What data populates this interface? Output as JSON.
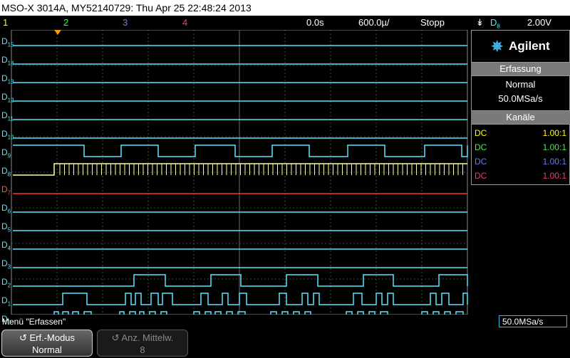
{
  "title_bar": "MSO-X 3014A, MY52140729: Thu Apr 25 22:48:24 2013",
  "top_bar": {
    "channels": [
      {
        "label": "1",
        "color": "#ffff00"
      },
      {
        "label": "2",
        "color": "#44ee44"
      },
      {
        "label": "3",
        "color": "#6677ff"
      },
      {
        "label": "4",
        "color": "#ff3377"
      }
    ],
    "time_position": "0.0s",
    "time_scale": "600.0µ/",
    "run_state": "Stopp",
    "trigger_source": "D",
    "trigger_source_sub": "8",
    "trigger_level": "2.00V"
  },
  "digital_channels": [
    {
      "label": "D",
      "sub": "15"
    },
    {
      "label": "D",
      "sub": "14"
    },
    {
      "label": "D",
      "sub": "13"
    },
    {
      "label": "D",
      "sub": "12"
    },
    {
      "label": "D",
      "sub": "11"
    },
    {
      "label": "D",
      "sub": "10"
    },
    {
      "label": "D",
      "sub": "9"
    },
    {
      "label": "D",
      "sub": "8"
    },
    {
      "label": "D",
      "sub": "7"
    },
    {
      "label": "D",
      "sub": "6"
    },
    {
      "label": "D",
      "sub": "5"
    },
    {
      "label": "D",
      "sub": "4"
    },
    {
      "label": "D",
      "sub": "3"
    },
    {
      "label": "D",
      "sub": "2"
    },
    {
      "label": "D",
      "sub": "1"
    },
    {
      "label": "D",
      "sub": "0"
    }
  ],
  "right_panel": {
    "brand": "Agilent",
    "acquisition_header": "Erfassung",
    "acquisition_mode": "Normal",
    "sample_rate": "50.0MSa/s",
    "channels_header": "Kanäle",
    "channels": [
      {
        "coupling": "DC",
        "ratio": "1.00:1",
        "color": "#ffff00"
      },
      {
        "coupling": "DC",
        "ratio": "1.00:1",
        "color": "#44ee44"
      },
      {
        "coupling": "DC",
        "ratio": "1.00:1",
        "color": "#6677ff"
      },
      {
        "coupling": "DC",
        "ratio": "1.00:1",
        "color": "#ff3377"
      }
    ]
  },
  "status": {
    "menu_label": "Menü \"Erfassen\"",
    "sample_rate_box": "50.0MSa/s"
  },
  "softkeys": [
    {
      "line1": "Erf.-Modus",
      "line2": "Normal",
      "enabled": true
    },
    {
      "line1": "Anz. Mittelw.",
      "line2": "8",
      "enabled": false
    }
  ],
  "colors": {
    "trace": "#55e6ff",
    "d8_trace": "#ffff99",
    "d7_trace": "#ff3322",
    "channel_label": "#55e6ff",
    "d7_label": "#ff5533",
    "grid": "#5a5a5a",
    "brand_accent": "#3fb7e6",
    "trigger_marker": "#ff9900"
  }
}
